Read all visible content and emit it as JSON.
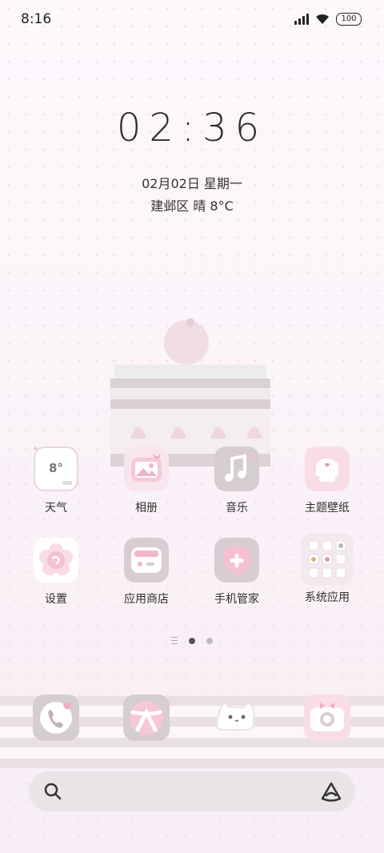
{
  "status_bar": {
    "time": "8:16",
    "battery": "100",
    "icons": [
      "signal-icon",
      "wifi-icon",
      "battery-icon"
    ]
  },
  "clock": {
    "time": "02:36",
    "date": "02月02日 星期一",
    "weather": "建邺区 晴 8°C"
  },
  "apps": [
    {
      "name": "weather",
      "label": "天气",
      "icon": "weather-widget-icon",
      "icon_text": "8°"
    },
    {
      "name": "gallery",
      "label": "相册",
      "icon": "photo-icon"
    },
    {
      "name": "music",
      "label": "音乐",
      "icon": "music-note-icon"
    },
    {
      "name": "themes",
      "label": "主题壁纸",
      "icon": "theme-shirt-icon"
    },
    {
      "name": "settings",
      "label": "设置",
      "icon": "gear-flower-icon"
    },
    {
      "name": "app-store",
      "label": "应用商店",
      "icon": "store-bag-icon"
    },
    {
      "name": "phone-manager",
      "label": "手机管家",
      "icon": "shield-icon"
    },
    {
      "name": "system-apps",
      "label": "系统应用",
      "icon": "folder-grid-icon"
    }
  ],
  "dock": [
    {
      "name": "phone",
      "icon": "phone-icon"
    },
    {
      "name": "browser",
      "icon": "browser-icon"
    },
    {
      "name": "messages",
      "icon": "message-cat-icon"
    },
    {
      "name": "camera",
      "icon": "camera-icon"
    }
  ],
  "page_indicator": {
    "pages": 2,
    "active": 1
  },
  "colors": {
    "accent_pink": "#f7d6e4",
    "icon_gray": "#d9cdd3",
    "text": "#2f2f2f"
  }
}
